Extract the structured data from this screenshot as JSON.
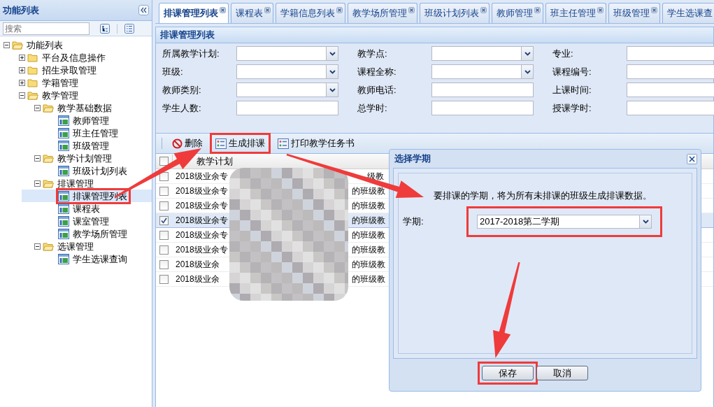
{
  "sidebar": {
    "title": "功能列表",
    "search": {
      "placeholder": "搜索"
    },
    "tree": [
      {
        "label": "功能列表",
        "kind": "folder",
        "expanded": true,
        "selected": false,
        "children": [
          {
            "label": "平台及信息操作",
            "kind": "folder",
            "expanded": false,
            "selected": false
          },
          {
            "label": "招生录取管理",
            "kind": "folder",
            "expanded": false,
            "selected": false
          },
          {
            "label": "学籍管理",
            "kind": "folder",
            "expanded": false,
            "selected": false
          },
          {
            "label": "教学管理",
            "kind": "folder",
            "expanded": true,
            "selected": false,
            "children": [
              {
                "label": "教学基础数据",
                "kind": "folder",
                "expanded": true,
                "selected": false,
                "children": [
                  {
                    "label": "教师管理",
                    "kind": "page",
                    "selected": false
                  },
                  {
                    "label": "班主任管理",
                    "kind": "page",
                    "selected": false
                  },
                  {
                    "label": "班级管理",
                    "kind": "page",
                    "selected": false
                  }
                ]
              },
              {
                "label": "教学计划管理",
                "kind": "folder",
                "expanded": true,
                "selected": false,
                "children": [
                  {
                    "label": "班级计划列表",
                    "kind": "page",
                    "selected": false
                  }
                ]
              },
              {
                "label": "排课管理",
                "kind": "folder",
                "expanded": true,
                "selected": false,
                "children": [
                  {
                    "label": "排课管理列表",
                    "kind": "page",
                    "selected": true,
                    "highlighted": true
                  },
                  {
                    "label": "课程表",
                    "kind": "page",
                    "selected": false
                  },
                  {
                    "label": "课室管理",
                    "kind": "page",
                    "selected": false
                  },
                  {
                    "label": "教学场所管理",
                    "kind": "page",
                    "selected": false
                  }
                ]
              },
              {
                "label": "选课管理",
                "kind": "folder",
                "expanded": true,
                "selected": false,
                "children": [
                  {
                    "label": "学生选课查询",
                    "kind": "page",
                    "selected": false
                  }
                ]
              }
            ]
          }
        ]
      }
    ]
  },
  "tabs": [
    {
      "label": "排课管理列表",
      "selected": true
    },
    {
      "label": "课程表",
      "selected": false
    },
    {
      "label": "学籍信息列表",
      "selected": false
    },
    {
      "label": "教学场所管理",
      "selected": false
    },
    {
      "label": "班级计划列表",
      "selected": false
    },
    {
      "label": "教师管理",
      "selected": false
    },
    {
      "label": "班主任管理",
      "selected": false
    },
    {
      "label": "班级管理",
      "selected": false
    },
    {
      "label": "学生选课查",
      "selected": false
    }
  ],
  "panel": {
    "title": "排课管理列表",
    "filters": [
      {
        "label": "所属教学计划:",
        "kind": "select"
      },
      {
        "label": "教学点:",
        "kind": "select"
      },
      {
        "label": "专业:",
        "kind": "text"
      },
      {
        "label": "班级:",
        "kind": "select"
      },
      {
        "label": "课程全称:",
        "kind": "select"
      },
      {
        "label": "课程编号:",
        "kind": "text"
      },
      {
        "label": "教师类别:",
        "kind": "select"
      },
      {
        "label": "教师电话:",
        "kind": "text"
      },
      {
        "label": "上课时间:",
        "kind": "text"
      },
      {
        "label": "学生人数:",
        "kind": "text"
      },
      {
        "label": "总学时:",
        "kind": "text"
      },
      {
        "label": "授课学时:",
        "kind": "text"
      }
    ],
    "toolbar": [
      {
        "label": "删除",
        "kind": "delete",
        "highlighted": false
      },
      {
        "label": "生成排课",
        "kind": "list",
        "highlighted": true
      },
      {
        "label": "打印教学任务书",
        "kind": "list",
        "highlighted": false
      }
    ],
    "table": {
      "header": {
        "checked": false,
        "column_1": "教学计划"
      },
      "rows": [
        {
          "checked": false,
          "column_1": "2018级业余专",
          "column_2": "级教"
        },
        {
          "checked": false,
          "column_1": "2018级业余专",
          "column_2": "的班级教"
        },
        {
          "checked": false,
          "column_1": "2018级业余专",
          "column_2": "的班级教"
        },
        {
          "checked": true,
          "column_1": "2018级业余专",
          "column_2": "的班级教"
        },
        {
          "checked": false,
          "column_1": "2018级业余专",
          "column_2": "的班级教"
        },
        {
          "checked": false,
          "column_1": "2018级业余专",
          "column_2": "的班级教"
        },
        {
          "checked": false,
          "column_1": "2018级业余",
          "column_2": "的班级教"
        },
        {
          "checked": false,
          "column_1": "2018级业余",
          "column_2": "的班级教"
        }
      ]
    }
  },
  "dialog": {
    "title": "选择学期",
    "message": "要排课的学期，将为所有未排课的班级生成排课数据。",
    "field": {
      "label": "学期:",
      "value": "2017-2018第二学期",
      "highlighted": true
    },
    "buttons": [
      {
        "label": "保存",
        "highlighted": true
      },
      {
        "label": "取消",
        "highlighted": false
      }
    ]
  }
}
